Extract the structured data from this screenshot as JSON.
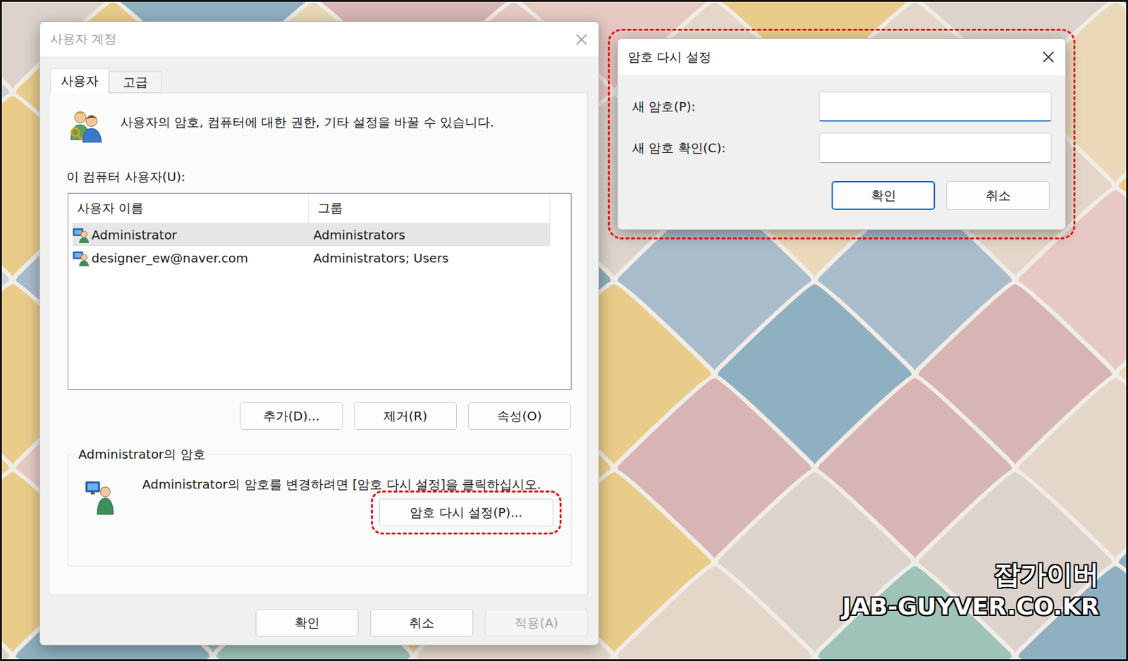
{
  "main_window": {
    "title": "사용자 계정",
    "active": false
  },
  "tabs": [
    {
      "label": "사용자",
      "selected": true
    },
    {
      "label": "고급",
      "selected": false
    }
  ],
  "description": "사용자의 암호, 컴퓨터에 대한 권한, 기타 설정을 바꿀 수 있습니다.",
  "users_label": "이 컴퓨터 사용자(U):",
  "table": {
    "columns": [
      "사용자 이름",
      "그룹"
    ],
    "rows": [
      {
        "cells": [
          "Administrator",
          "Administrators"
        ],
        "selected": true
      },
      {
        "cells": [
          "designer_ew@naver.com",
          "Administrators; Users"
        ],
        "selected": false
      }
    ]
  },
  "user_buttons": [
    "추가(D)...",
    "제거(R)",
    "속성(O)"
  ],
  "password_group": {
    "title": "Administrator의 암호",
    "text": "Administrator의 암호를 변경하려면 [암호 다시 설정]을 클릭하십시오.",
    "button": "암호 다시 설정(P)...",
    "highlighted": true
  },
  "dialog_buttons": [
    {
      "label": "확인",
      "disabled": false
    },
    {
      "label": "취소",
      "disabled": false
    },
    {
      "label": "적용(A)",
      "disabled": true
    }
  ],
  "reset_dialog": {
    "title": "암호 다시 설정",
    "active": true,
    "highlighted": true,
    "fields": [
      {
        "label": "새 암호(P):",
        "value": "",
        "focused": true
      },
      {
        "label": "새 암호 확인(C):",
        "value": "",
        "focused": false
      }
    ],
    "buttons": [
      {
        "label": "확인",
        "default": true
      },
      {
        "label": "취소",
        "default": false
      }
    ]
  },
  "watermark": {
    "lines": [
      "잡가이버",
      "JAB-GUYVER.CO.KR"
    ]
  }
}
